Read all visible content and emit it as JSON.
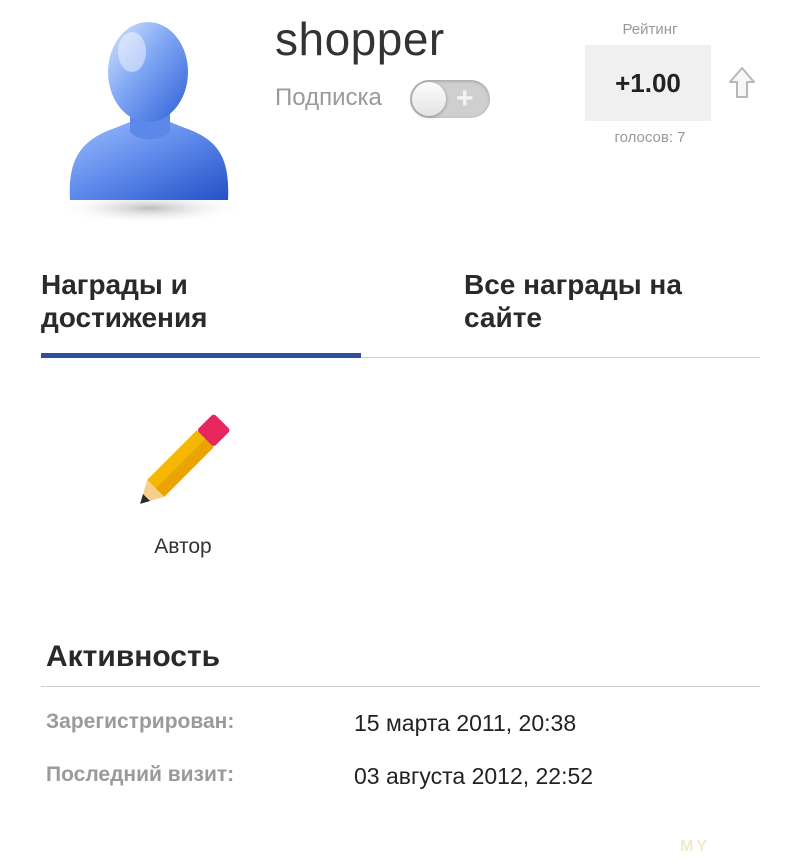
{
  "profile": {
    "username": "shopper",
    "subscription_label": "Подписка",
    "toggle_symbol": "+"
  },
  "rating": {
    "label": "Рейтинг",
    "value": "+1.00",
    "votes": "голосов: 7"
  },
  "tabs": [
    {
      "label": "Награды и достижения",
      "active": true
    },
    {
      "label": "Все награды на сайте",
      "active": false
    }
  ],
  "awards": [
    {
      "label": "Автор",
      "icon": "pencil-icon"
    }
  ],
  "activity": {
    "title": "Активность",
    "rows": [
      {
        "label": "Зарегистрирован:",
        "value": "15 марта 2011, 20:38"
      },
      {
        "label": "Последний визит:",
        "value": "03 августа 2012, 22:52"
      }
    ]
  },
  "watermark": "MY",
  "colors": {
    "accent": "#2c4fa0",
    "avatar": "#4f7fe0",
    "pencil_body": "#f5b700",
    "pencil_eraser": "#e8265e",
    "rating_bg": "#f0f0f0"
  }
}
